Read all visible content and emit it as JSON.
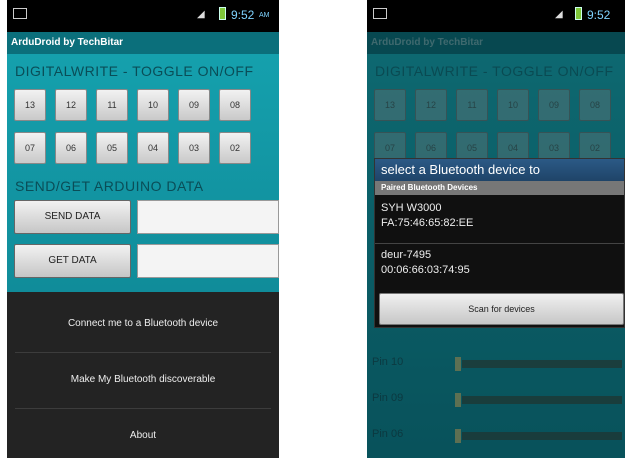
{
  "status_bar": {
    "time": "9:52",
    "time_suffix": "AM",
    "signal": "◢"
  },
  "left_screen": {
    "app_title": "ArduDroid by TechBitar",
    "digitalwrite_title": "DIGITALWRITE - TOGGLE ON/OFF",
    "pins_row1": [
      "13",
      "12",
      "11",
      "10",
      "09",
      "08"
    ],
    "pins_row2": [
      "07",
      "06",
      "05",
      "04",
      "03",
      "02"
    ],
    "data_title": "SEND/GET ARDUINO DATA",
    "send_label": "SEND DATA",
    "get_label": "GET DATA",
    "send_value": "",
    "get_value": "",
    "menu": {
      "connect": "Connect me to a Bluetooth device",
      "discoverable": "Make My Bluetooth discoverable",
      "about": "About"
    }
  },
  "right_screen": {
    "app_title": "ArduDroid by TechBitar",
    "digitalwrite_title": "DIGITALWRITE - TOGGLE ON/OFF",
    "pins_row1": [
      "13",
      "12",
      "11",
      "10",
      "09",
      "08"
    ],
    "pins_row2": [
      "07",
      "06",
      "05",
      "04",
      "03",
      "02"
    ],
    "dialog": {
      "title": "select a Bluetooth device to",
      "subtitle": "Paired Bluetooth Devices",
      "devices": [
        {
          "name": "SYH W3000",
          "address": "FA:75:46:65:82:EE"
        },
        {
          "name": "deur-7495",
          "address": "00:06:66:03:74:95"
        }
      ],
      "scan_label": "Scan for devices"
    },
    "pwm_rows": [
      "Pin 10",
      "Pin 09",
      "Pin 06"
    ]
  },
  "colors": {
    "teal": "#15a0ad",
    "dark_teal": "#0b6f7b",
    "menu_bg": "#232323",
    "dialog_title": "#2b5a86"
  }
}
